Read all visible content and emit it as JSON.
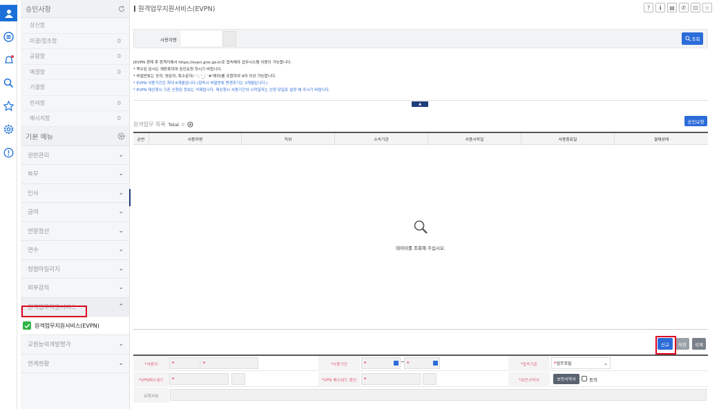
{
  "iconbar": {
    "icons": [
      "user-icon",
      "menu-list-icon",
      "bell-icon",
      "search-icon",
      "star-icon",
      "settings-icon",
      "info-icon"
    ]
  },
  "sidebar": {
    "approval_header": "승인사항",
    "approval_items": [
      {
        "label": "상신함",
        "count": ""
      },
      {
        "label": "미결/접조함",
        "count": "0"
      },
      {
        "label": "공람함",
        "count": "0"
      },
      {
        "label": "예결함",
        "count": "0"
      },
      {
        "label": "기결함",
        "count": ""
      },
      {
        "label": "반려함",
        "count": "0"
      },
      {
        "label": "메시지함",
        "count": "0"
      }
    ],
    "basic_header": "기본 메뉴",
    "menus": [
      {
        "label": "권한관리",
        "chev": "⌄"
      },
      {
        "label": "복무",
        "chev": "⌄"
      },
      {
        "label": "인사",
        "chev": "⌄"
      },
      {
        "label": "급여",
        "chev": "⌄"
      },
      {
        "label": "연말정산",
        "chev": "⌄"
      },
      {
        "label": "연수",
        "chev": "⌄"
      },
      {
        "label": "청렴마일리지",
        "chev": "⌄"
      },
      {
        "label": "외부강의",
        "chev": "⌄"
      },
      {
        "label": "원격업무지원서비스",
        "chev": "⌃"
      }
    ],
    "active_sub": "원격업무지원서비스(EVPN)",
    "menus_after": [
      {
        "label": "교원능력개발평가",
        "chev": "⌄"
      },
      {
        "label": "연계현황",
        "chev": "⌄"
      }
    ]
  },
  "page": {
    "title": "원격업무지원서비스(EVPN)",
    "top_icons": [
      "?",
      "ℹ",
      "▤",
      "✆",
      "⊡",
      "☆"
    ]
  },
  "search": {
    "user_label": "사용자명",
    "search_button": "조회"
  },
  "notice": {
    "line1": "[EVPN 경제 후 원격지에서 https://evpn.gne.go.kr로 접속해야 업무시스템 이용이 가능합니다.",
    "line2": "* 목수된 문서는 재등록하여 승인요청 하시기 바랍니다.",
    "line3": "* 비밀번호는 숫자, 영문자, 특수문자( '.', '_', '#'제외)를 조합하여 9자 이상 가능합니다.",
    "line4": "* EVPN 사용기간은 최대 6개월입니다.(접속시 비밀번호 변경주기는 3개월입니다.)",
    "line5": "* EVPN 재신청시 기존 신청된 정보는 삭제됩니다. 재신청시 사용기간의 시작일자는 신청 당일로 설정 해 주시기 바랍니다.",
    "collapse": "▲"
  },
  "list": {
    "title": "원격업무 목록",
    "total_label": "Total",
    "total_count": "0",
    "approve_button": "승인요청",
    "columns": [
      "순번",
      "사용자명",
      "직위",
      "소속기관",
      "사용시작일",
      "사용종료일",
      "결재상태"
    ],
    "empty_message": "데이터를 조회해 주십시오."
  },
  "actions": {
    "new": "신규",
    "save": "저장",
    "delete": "삭제"
  },
  "form": {
    "user_label": "*사용자",
    "period_label": "*사용기간",
    "purpose_label": "*접속기준",
    "purpose_value": "업무포털",
    "pw_label": "*VPN패스워드",
    "pw_confirm_label": "*VPN 패스워드 확인",
    "security_label": "*보안서약서",
    "security_button": "보안서약서",
    "agree_label": "동의",
    "reason_label": "요청사유",
    "date_sep": "~"
  },
  "colors": {
    "accent": "#2b6cd9",
    "highlight": "#e0001b"
  }
}
